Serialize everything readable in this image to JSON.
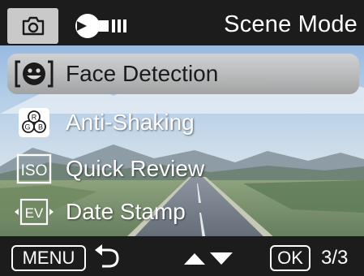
{
  "header": {
    "camera_tab_icon": "camera-icon",
    "settings_tab_icon": "wrench-settings-icon",
    "title": "Scene Mode"
  },
  "menu": {
    "items": [
      {
        "label": "Face Detection",
        "icon": "face-detection-icon",
        "selected": true
      },
      {
        "label": "Anti-Shaking",
        "icon": "rgb-color-icon",
        "selected": false
      },
      {
        "label": "Quick Review",
        "icon": "iso-icon",
        "selected": false
      },
      {
        "label": "Date Stamp",
        "icon": "ev-icon",
        "selected": false
      }
    ],
    "rgb_icon_letters": [
      "R",
      "G",
      "B"
    ],
    "iso_icon_text": "ISO",
    "ev_icon_text": "EV"
  },
  "footer": {
    "menu_label": "MENU",
    "back_icon": "back-arrow-icon",
    "nav_icon": "up-down-arrows-icon",
    "ok_label": "OK",
    "page_indicator": "3/3"
  },
  "colors": {
    "bar_background": "#1c1c1c",
    "selected_highlight": "#c0c0c0",
    "camera_tab": "#c9c9c9",
    "text": "#ffffff"
  }
}
